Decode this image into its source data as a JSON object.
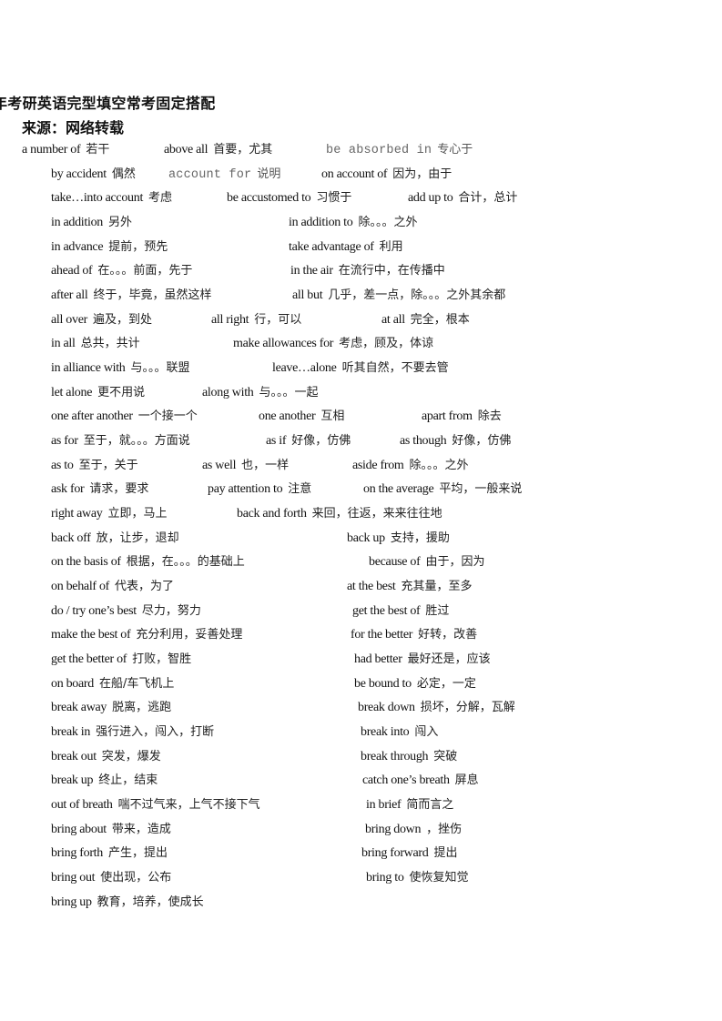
{
  "document": {
    "title": "年考研英语完型填空常考固定搭配",
    "source": "来源：网络转载"
  },
  "rows": [
    [
      {
        "phrase": "a number of",
        "meaning": "若干"
      },
      {
        "phrase": "above all",
        "meaning": "首要，尤其"
      },
      {
        "phrase": "be absorbed in",
        "meaning": "专心于",
        "style": "mono"
      }
    ],
    [
      {
        "phrase": "by accident",
        "meaning": "偶然"
      },
      {
        "phrase": "account for",
        "meaning": "说明",
        "style": "mono"
      },
      {
        "phrase": "on account of",
        "meaning": "因为，由于"
      }
    ],
    [
      {
        "phrase": "take…into account",
        "meaning": "考虑"
      },
      {
        "phrase": "be accustomed to",
        "meaning": "习惯于"
      },
      {
        "phrase": "add up to",
        "meaning": "合计，总计"
      }
    ],
    [
      {
        "phrase": "in addition",
        "meaning": "另外"
      },
      {
        "phrase": "in addition to",
        "meaning": "除。。。之外"
      }
    ],
    [
      {
        "phrase": "in advance",
        "meaning": "提前，预先"
      },
      {
        "phrase": "take advantage of",
        "meaning": "利用"
      }
    ],
    [
      {
        "phrase": "ahead of",
        "meaning": "在。。。前面，先于"
      },
      {
        "phrase": "in the air",
        "meaning": "在流行中，在传播中"
      }
    ],
    [
      {
        "phrase": "after all",
        "meaning": "终于，毕竟，虽然这样"
      },
      {
        "phrase": "all but",
        "meaning": "几乎，差一点，除。。。之外其余都"
      }
    ],
    [
      {
        "phrase": "all over",
        "meaning": "遍及，到处"
      },
      {
        "phrase": "all right",
        "meaning": "行，可以"
      },
      {
        "phrase": "at all",
        "meaning": "完全，根本"
      }
    ],
    [
      {
        "phrase": "in all",
        "meaning": "总共，共计"
      },
      {
        "phrase": "make allowances for",
        "meaning": "考虑，顾及，体谅"
      }
    ],
    [
      {
        "phrase": "in alliance with",
        "meaning": "与。。。联盟"
      },
      {
        "phrase": "leave…alone",
        "meaning": "听其自然，不要去管"
      }
    ],
    [
      {
        "phrase": "let alone",
        "meaning": "更不用说"
      },
      {
        "phrase": "along with",
        "meaning": "与。。。一起"
      }
    ],
    [
      {
        "phrase": "one after another",
        "meaning": "一个接一个"
      },
      {
        "phrase": "one another",
        "meaning": "互相"
      },
      {
        "phrase": "apart from",
        "meaning": "除去"
      }
    ],
    [
      {
        "phrase": "as for",
        "meaning": "至于，就。。。方面说"
      },
      {
        "phrase": "as if",
        "meaning": "好像，仿佛"
      },
      {
        "phrase": "as though",
        "meaning": "好像，仿佛"
      }
    ],
    [
      {
        "phrase": "as to",
        "meaning": "至于，关于"
      },
      {
        "phrase": "as well",
        "meaning": "也，一样"
      },
      {
        "phrase": "aside from",
        "meaning": "除。。。之外"
      }
    ],
    [
      {
        "phrase": "ask for",
        "meaning": "请求，要求"
      },
      {
        "phrase": "pay attention to",
        "meaning": "注意"
      },
      {
        "phrase": "on the average",
        "meaning": "平均，一般来说"
      }
    ],
    [
      {
        "phrase": "right away",
        "meaning": "立即，马上"
      },
      {
        "phrase": "back and forth",
        "meaning": "来回，往返，来来往往地"
      }
    ],
    [
      {
        "phrase": "back off",
        "meaning": "放，让步，退却"
      },
      {
        "phrase": "back up",
        "meaning": "支持，援助"
      }
    ],
    [
      {
        "phrase": "on the basis of",
        "meaning": "根据，在。。。的基础上"
      },
      {
        "phrase": "because of",
        "meaning": "由于，因为"
      }
    ],
    [
      {
        "phrase": "on behalf of",
        "meaning": "代表，为了"
      },
      {
        "phrase": "at the best",
        "meaning": "充其量，至多"
      }
    ],
    [
      {
        "phrase": "do / try one’s best",
        "meaning": "尽力，努力"
      },
      {
        "phrase": "get the best of",
        "meaning": "胜过"
      }
    ],
    [
      {
        "phrase": "make the best of",
        "meaning": "充分利用，妥善处理"
      },
      {
        "phrase": "for the better",
        "meaning": "好转，改善"
      }
    ],
    [
      {
        "phrase": "get the better of",
        "meaning": "打败，智胜"
      },
      {
        "phrase": "had better",
        "meaning": "最好还是，应该"
      }
    ],
    [
      {
        "phrase": "on board",
        "meaning": "在船/车飞机上"
      },
      {
        "phrase": "be bound to",
        "meaning": "必定，一定"
      }
    ],
    [
      {
        "phrase": "break away",
        "meaning": "脱离，逃跑"
      },
      {
        "phrase": "break down",
        "meaning": "损坏，分解，瓦解"
      }
    ],
    [
      {
        "phrase": "break in",
        "meaning": "强行进入，闯入，打断"
      },
      {
        "phrase": "break into",
        "meaning": "闯入"
      }
    ],
    [
      {
        "phrase": "break out",
        "meaning": "突发，爆发"
      },
      {
        "phrase": "break through",
        "meaning": "突破"
      }
    ],
    [
      {
        "phrase": "break up",
        "meaning": "终止，结束"
      },
      {
        "phrase": "catch one’s breath",
        "meaning": "屏息"
      }
    ],
    [
      {
        "phrase": "out of breath",
        "meaning": "喘不过气来，上气不接下气"
      },
      {
        "phrase": "in brief",
        "meaning": "简而言之"
      }
    ],
    [
      {
        "phrase": "bring about",
        "meaning": "带来，造成"
      },
      {
        "phrase": "bring down",
        "meaning": "，挫伤"
      }
    ],
    [
      {
        "phrase": "bring forth",
        "meaning": "产生，提出"
      },
      {
        "phrase": "bring forward",
        "meaning": "提出"
      }
    ],
    [
      {
        "phrase": "bring out",
        "meaning": "使出现，公布"
      },
      {
        "phrase": "bring to",
        "meaning": "使恢复知觉"
      }
    ],
    [
      {
        "phrase": "bring up",
        "meaning": "教育，培养，使成长"
      }
    ]
  ]
}
